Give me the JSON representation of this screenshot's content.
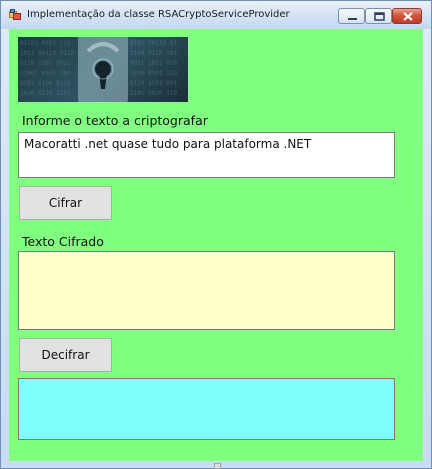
{
  "window": {
    "title": "Implementação da classe RSACryptoServiceProvider",
    "app_icon": "winforms-app-icon",
    "controls": [
      "minimize-icon",
      "maximize-icon",
      "close-icon"
    ]
  },
  "form": {
    "background_color": "#80ff80",
    "banner_image": "padlock-keyhole-image",
    "input_label": "Informe o texto a criptografar",
    "input_value": "Macoratti .net quase tudo para plataforma .NET",
    "encrypt_button": "Cifrar",
    "encrypted_label": "Texto Cifrado",
    "encrypted_value": "",
    "encrypted_bg": "#ffffcc",
    "decrypt_button": "Decifrar",
    "decrypted_value": "",
    "decrypted_bg": "#80ffff"
  }
}
